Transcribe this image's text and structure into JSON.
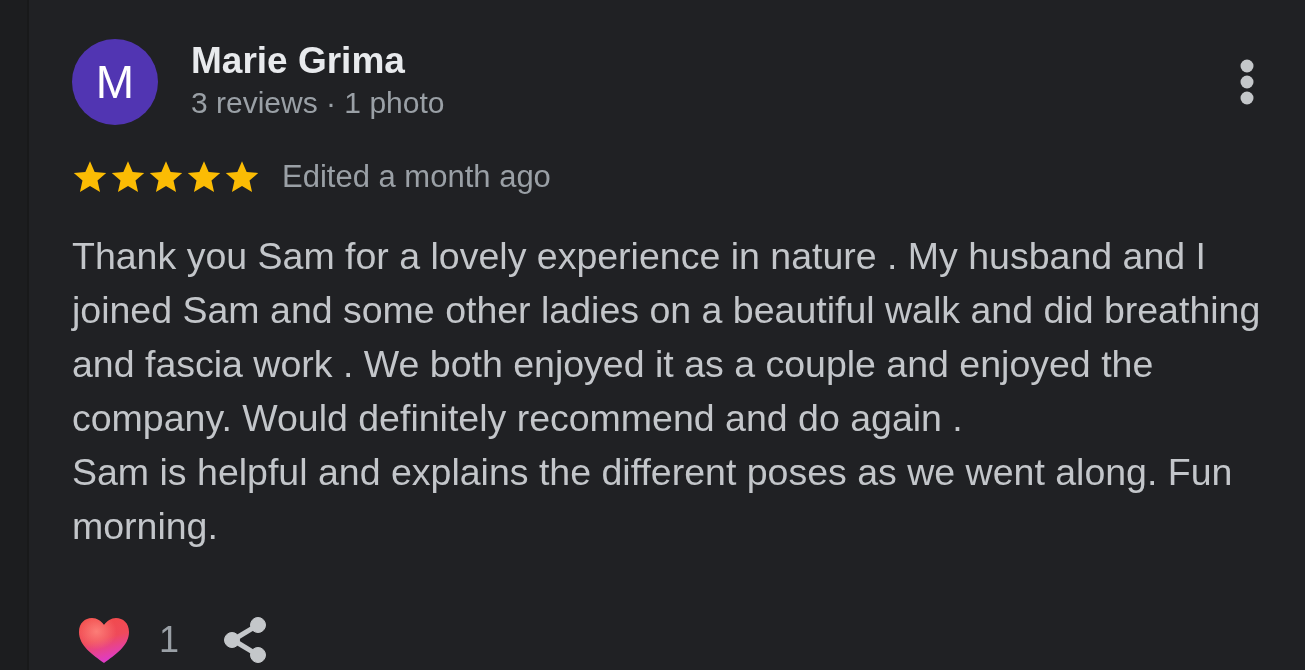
{
  "review": {
    "avatar_letter": "M",
    "author": "Marie Grima",
    "author_meta": "3 reviews · 1 photo",
    "stars": 5,
    "time": "Edited a month ago",
    "text": "Thank you Sam for a lovely experience in nature . My husband and I joined Sam and some other ladies on a beautiful walk and did breathing and fascia work . We both enjoyed it as a couple and enjoyed the company. Would definitely recommend and do again .\nSam is helpful and explains the different poses as we went along. Fun morning.",
    "reaction_count": "1"
  }
}
